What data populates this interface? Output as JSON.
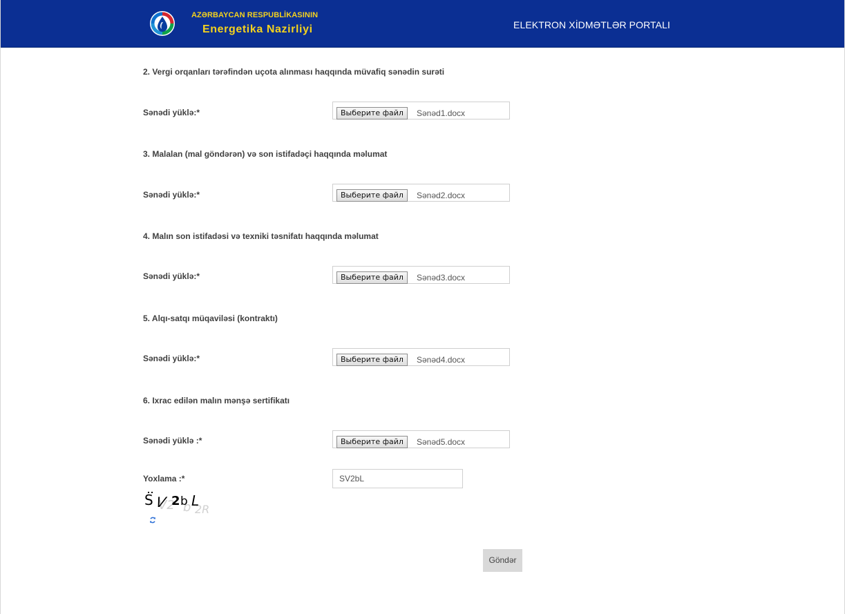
{
  "header": {
    "brand_top": "AZƏRBAYCAN RESPUBLİKASININ",
    "brand_main": "Energetika Nazirliyi",
    "portal_title": "ELEKTRON XİDMƏTLƏR PORTALI",
    "logo_icon": "ministry-drop-logo-icon"
  },
  "form": {
    "sections": [
      {
        "title": "2. Vergi orqanları tərəfindən uçota alınması haqqında müvafiq sənədin surəti",
        "upload_label": "Sənədi yüklə:*",
        "file_button_label": "Выберите файл",
        "file_name": "Sənəd1.docx"
      },
      {
        "title": "3. Malalan (mal göndərən) və son istifadəçi haqqında məlumat",
        "upload_label": "Sənədi yüklə:*",
        "file_button_label": "Выберите файл",
        "file_name": "Sənəd2.docx"
      },
      {
        "title": "4. Malın son istifadəsi və texniki təsnifatı haqqında məlumat",
        "upload_label": "Sənədi yüklə:*",
        "file_button_label": "Выберите файл",
        "file_name": "Sənəd3.docx"
      },
      {
        "title": "5. Alqı-satqı müqaviləsi (kontraktı)",
        "upload_label": "Sənədi yüklə:*",
        "file_button_label": "Выберите файл",
        "file_name": "Sənəd4.docx"
      },
      {
        "title": "6. Ixrac edilən malın mənşə sertifikatı",
        "upload_label": "Sənədi yüklə :*",
        "file_button_label": "Выберите файл",
        "file_name": "Sənəd5.docx"
      }
    ],
    "captcha": {
      "label": "Yoxlama :*",
      "input_value": "SV2bL",
      "image_text": "SV2bL",
      "refresh_icon": "refresh-icon"
    },
    "submit_label": "Göndər"
  },
  "colors": {
    "header_background": "#0b2f93",
    "brand_yellow": "#f4d21e",
    "portal_title": "#ffffff",
    "body_text": "#3f3f3f",
    "button_gray": "#d9d9d9"
  }
}
